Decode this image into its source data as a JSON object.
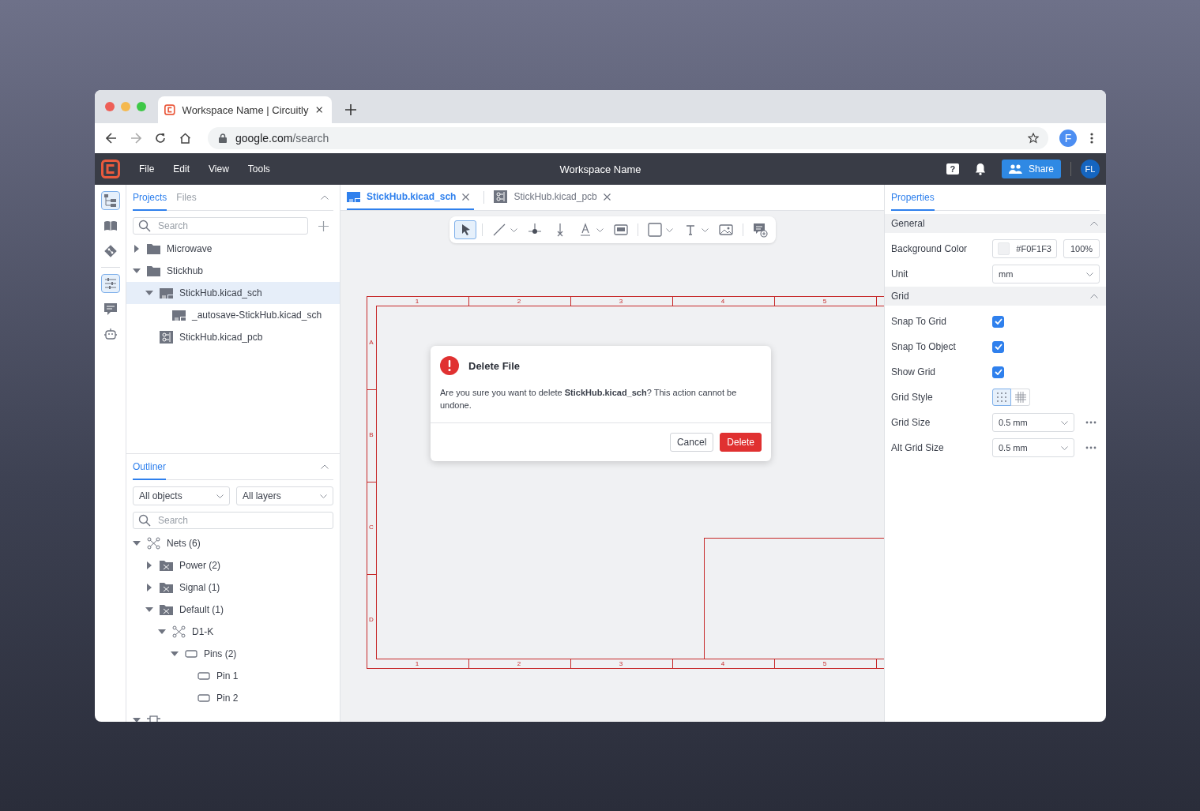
{
  "browser": {
    "tab_title": "Workspace Name | Circuitly",
    "url_host": "google.com",
    "url_path": "/search",
    "profile_initial": "F"
  },
  "app": {
    "menu": [
      "File",
      "Edit",
      "View",
      "Tools"
    ],
    "workspace_name": "Workspace Name",
    "share_label": "Share",
    "avatar": "FL",
    "help_glyph": "?"
  },
  "rail": [
    {
      "kind": "tree",
      "selected": true
    },
    {
      "kind": "book",
      "selected": false
    },
    {
      "kind": "git",
      "selected": false
    },
    {
      "kind": "sliders",
      "selected": true
    },
    {
      "kind": "comment",
      "selected": false
    },
    {
      "kind": "bot",
      "selected": false
    }
  ],
  "projects": {
    "tabs": [
      {
        "label": "Projects",
        "selected": true
      },
      {
        "label": "Files",
        "selected": false
      }
    ],
    "search_placeholder": "Search",
    "tree": [
      {
        "label": "Microwave",
        "kind": "folder",
        "expanded": false,
        "selected": false
      },
      {
        "label": "Stickhub",
        "kind": "folder",
        "expanded": true,
        "selected": false,
        "children": [
          {
            "label": "StickHub.kicad_sch",
            "kind": "sch",
            "expanded": true,
            "selected": true,
            "children": [
              {
                "label": "_autosave-StickHub.kicad_sch",
                "kind": "sch",
                "selected": false
              }
            ]
          },
          {
            "label": "StickHub.kicad_pcb",
            "kind": "pcb",
            "selected": false
          }
        ]
      }
    ]
  },
  "outliner": {
    "title": "Outliner",
    "filters": [
      "All objects",
      "All layers"
    ],
    "search_placeholder": "Search",
    "tree": [
      {
        "label": "Nets (6)",
        "kind": "net",
        "expanded": true,
        "selected": false,
        "children": [
          {
            "label": "Power (2)",
            "kind": "netclass",
            "expanded": false,
            "selected": false
          },
          {
            "label": "Signal (1)",
            "kind": "netclass",
            "expanded": false,
            "selected": false
          },
          {
            "label": "Default (1)",
            "kind": "netclass",
            "expanded": true,
            "selected": false,
            "children": [
              {
                "label": "D1-K",
                "kind": "net",
                "expanded": true,
                "selected": false,
                "children": [
                  {
                    "label": "Pins (2)",
                    "kind": "pin",
                    "expanded": true,
                    "selected": false,
                    "children": [
                      {
                        "label": "Pin 1",
                        "kind": "pin",
                        "selected": false
                      },
                      {
                        "label": "Pin 2",
                        "kind": "pin",
                        "selected": false
                      }
                    ]
                  }
                ]
              }
            ]
          }
        ]
      },
      {
        "kind": "symbol",
        "expanded": true,
        "selected": false
      }
    ]
  },
  "editor_tabs": [
    {
      "label": "StickHub.kicad_sch",
      "kind": "sch",
      "selected": true
    },
    {
      "label": "StickHub.kicad_pcb",
      "kind": "pcb",
      "selected": false
    }
  ],
  "toolbar": [
    [
      {
        "kind": "select",
        "selected": true,
        "has_menu": false
      }
    ],
    [
      {
        "kind": "line",
        "selected": false,
        "has_menu": true
      },
      {
        "kind": "junction",
        "selected": false,
        "has_menu": false
      },
      {
        "kind": "no_connect",
        "selected": false,
        "has_menu": false
      },
      {
        "kind": "label",
        "selected": false,
        "has_menu": true
      },
      {
        "kind": "sheet",
        "selected": false,
        "has_menu": false
      }
    ],
    [
      {
        "kind": "rect",
        "selected": false,
        "has_menu": true
      },
      {
        "kind": "text",
        "selected": false,
        "has_menu": true
      },
      {
        "kind": "image",
        "selected": false,
        "has_menu": false
      }
    ],
    [
      {
        "kind": "comment",
        "selected": false,
        "has_menu": false
      }
    ]
  ],
  "sheet": {
    "top_labels": [
      "1",
      "2",
      "3",
      "4",
      "5"
    ],
    "bottom_labels": [
      "1",
      "2",
      "3",
      "4",
      "5"
    ],
    "left_labels": [
      "A",
      "B",
      "C",
      "D"
    ]
  },
  "dialog": {
    "title": "Delete File",
    "message": "Are you sure you want to delete **StickHub.kicad_sch**? This action cannot be undone.",
    "buttons": [
      {
        "label": "Cancel",
        "kind": "secondary"
      },
      {
        "label": "Delete",
        "kind": "danger"
      }
    ]
  },
  "properties": {
    "tab": "Properties",
    "sections": [
      {
        "title": "General",
        "expanded": true,
        "rows": [
          {
            "kind": "color",
            "label": "Background Color",
            "value": "#F0F1F3",
            "opacity": "100%"
          },
          {
            "kind": "select",
            "label": "Unit",
            "value": "mm"
          }
        ]
      },
      {
        "title": "Grid",
        "expanded": true,
        "rows": [
          {
            "kind": "checkbox",
            "label": "Snap To Grid",
            "checked": true
          },
          {
            "kind": "checkbox",
            "label": "Snap To Object",
            "checked": true
          },
          {
            "kind": "checkbox",
            "label": "Show Grid",
            "checked": true
          },
          {
            "kind": "grid_style",
            "label": "Grid Style",
            "options": [
              {
                "kind": "dots",
                "selected": true
              },
              {
                "kind": "lines",
                "selected": false
              }
            ]
          },
          {
            "kind": "select_more",
            "label": "Grid Size",
            "value": "0.5 mm"
          },
          {
            "kind": "select_more",
            "label": "Alt Grid Size",
            "value": "0.5 mm"
          }
        ]
      }
    ]
  }
}
